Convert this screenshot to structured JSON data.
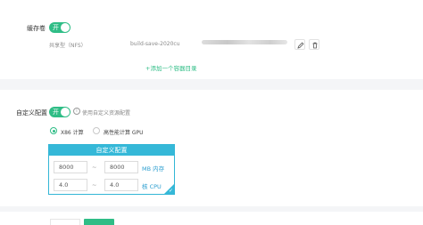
{
  "storage": {
    "title": "缓存卷",
    "switch_label": "开",
    "volume_type": "共享型（NFS）",
    "volume_name": "build-save-2020cu",
    "add_link": "+添加一个容器目录",
    "edit_icon": "pencil-icon",
    "delete_icon": "trash-icon"
  },
  "custom_config": {
    "title": "自定义配置",
    "switch_label": "开",
    "hint": "使用自定义资源配置",
    "arch_options": [
      {
        "label": "X86 计算",
        "selected": true
      },
      {
        "label": "高性能计算 GPU",
        "selected": false
      }
    ],
    "panel_title": "自定义配置",
    "rows": [
      {
        "min": "8000",
        "max": "8000",
        "unit": "MB 内存"
      },
      {
        "min": "4.0",
        "max": "4.0",
        "unit": "核 CPU"
      }
    ],
    "dash": "~",
    "selected_check": "✓"
  },
  "colors": {
    "accent": "#2fbd86",
    "panel_blue": "#35b8d8"
  }
}
